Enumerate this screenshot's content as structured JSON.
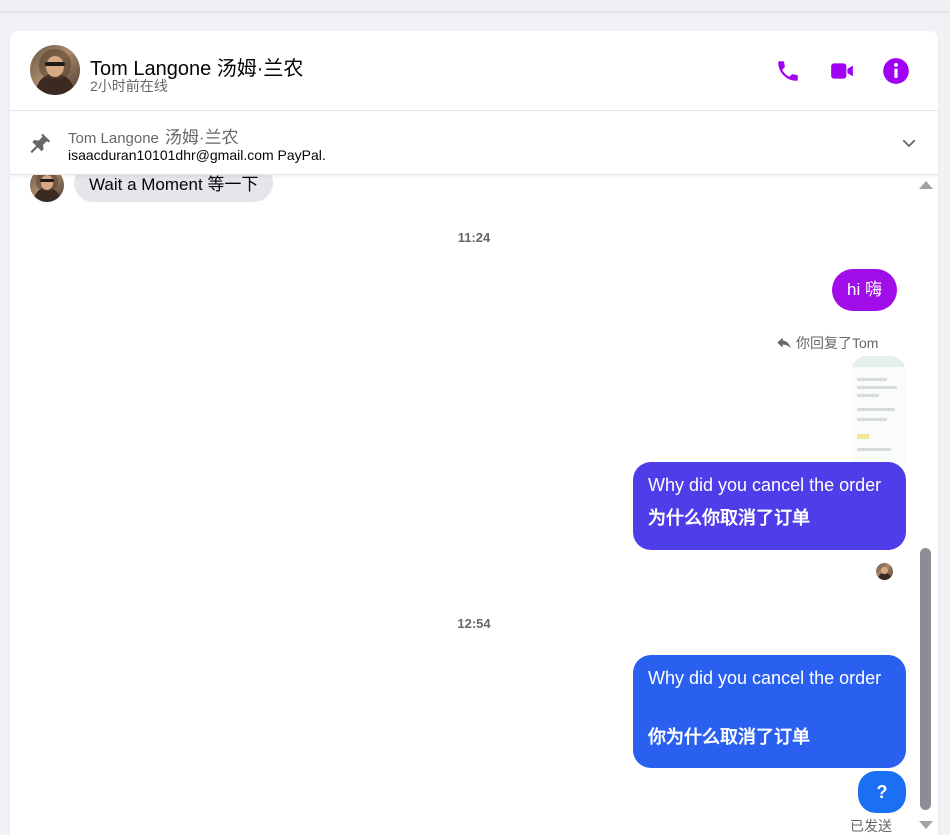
{
  "header": {
    "contact_name": "Tom Langone  汤姆·兰农",
    "status": "2小时前在线",
    "accent_color": "#a100f5",
    "icons": [
      "phone-icon",
      "video-camera-icon",
      "info-icon"
    ]
  },
  "pinned": {
    "sender_en": "Tom Langone",
    "sender_zh": "汤姆·兰农",
    "text": "isaacduran10101dhr@gmail.com PayPal.",
    "icons": [
      "pin-icon",
      "chevron-down-icon"
    ]
  },
  "messages": {
    "incoming_partial": "Wait a Moment  等一下",
    "time_1": "11:24",
    "out_hi": "hi  嗨",
    "reply_label": "你回复了Tom",
    "bubble_1_en": "Why did you cancel the order",
    "bubble_1_zh": "为什么你取消了订单",
    "time_2": "12:54",
    "bubble_2_en": "Why did you cancel the order",
    "bubble_2_zh": "你为什么取消了订单",
    "bubble_3": "?",
    "sent_status": "已发送",
    "bubble_colors": [
      "#a10de8",
      "#4f3dea",
      "#2a60f0",
      "#1a6ff2"
    ]
  }
}
